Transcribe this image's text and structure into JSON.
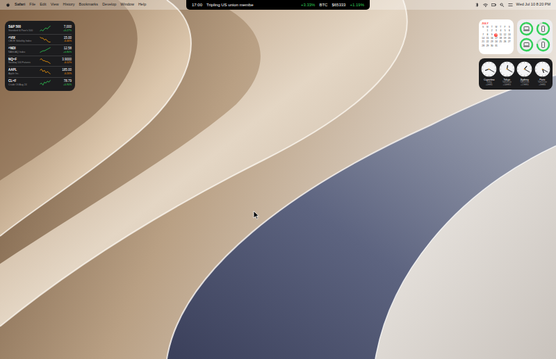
{
  "menu_bar": {
    "app": "Safari",
    "menus": [
      "File",
      "Edit",
      "View",
      "History",
      "Bookmarks",
      "Develop",
      "Window",
      "Help"
    ],
    "ticker": {
      "time": "17:00",
      "headline": "Tripling US union membe",
      "index_change": "+3.33%",
      "btc_label": "BTC",
      "btc_price": "$65333",
      "btc_change": "+1.19%"
    },
    "clock": "Wed Jul 10  8:20 PM"
  },
  "stocks": [
    {
      "symbol": "S&P 500",
      "name": "Standard & Poor's 500",
      "value": "7,000",
      "change": "+0.27%",
      "up": true,
      "trend": [
        4,
        5,
        4,
        6,
        7,
        6,
        8,
        9
      ]
    },
    {
      "symbol": "^VIX",
      "name": "CBOE Volatility Index",
      "value": "15.00",
      "change": "-0.40%",
      "up": false,
      "trend": [
        9,
        8,
        8,
        6,
        7,
        5,
        4,
        4
      ]
    },
    {
      "symbol": "^NDI",
      "name": "NASDAQ Index",
      "value": "12.58",
      "change": "+0.80%",
      "up": true,
      "trend": [
        3,
        4,
        5,
        5,
        6,
        7,
        8,
        9
      ]
    },
    {
      "symbol": "NQ=F",
      "name": "Nasdaq 100 Futures",
      "value": "3.9000",
      "change": "-0.12%",
      "up": false,
      "trend": [
        8,
        9,
        7,
        7,
        6,
        6,
        5,
        4
      ]
    },
    {
      "symbol": "AAPL",
      "name": "Apple Inc.",
      "value": "185.00",
      "change": "-0.20%",
      "up": false,
      "trend": [
        7,
        8,
        6,
        7,
        5,
        6,
        5,
        4
      ]
    },
    {
      "symbol": "CL=F",
      "name": "Crude Oil Aug 24",
      "value": "78.79",
      "change": "+0.90%",
      "up": true,
      "trend": [
        4,
        5,
        3,
        6,
        5,
        7,
        6,
        8
      ]
    }
  ],
  "calendar": {
    "month": "JULY",
    "weekdays": [
      "S",
      "M",
      "T",
      "W",
      "T",
      "F",
      "S"
    ],
    "weeks": [
      [
        "",
        "1",
        "2",
        "3",
        "4",
        "5",
        "6"
      ],
      [
        "7",
        "8",
        "9",
        "10",
        "11",
        "12",
        "13"
      ],
      [
        "14",
        "15",
        "16",
        "17",
        "18",
        "19",
        "20"
      ],
      [
        "21",
        "22",
        "23",
        "24",
        "25",
        "26",
        "27"
      ],
      [
        "28",
        "29",
        "30",
        "31",
        "",
        "",
        ""
      ]
    ],
    "today": "10"
  },
  "batteries": [
    {
      "kind": "laptop",
      "level": 0.95
    },
    {
      "kind": "phone",
      "level": 0.85
    },
    {
      "kind": "laptop",
      "level": 1
    },
    {
      "kind": "phone",
      "level": 0.75
    }
  ],
  "world_clocks": [
    {
      "city": "Cupertino",
      "day": "Today",
      "offset": "+0HRS",
      "hour": 8,
      "minute": 20
    },
    {
      "city": "Tokyo",
      "day": "Tomorrow",
      "offset": "+16HRS",
      "hour": 12,
      "minute": 20
    },
    {
      "city": "Sydney",
      "day": "Tomorrow",
      "offset": "+17HRS",
      "hour": 1,
      "minute": 20
    },
    {
      "city": "Paris",
      "day": "Tomorrow",
      "offset": "+9HRS",
      "hour": 5,
      "minute": 20
    }
  ]
}
